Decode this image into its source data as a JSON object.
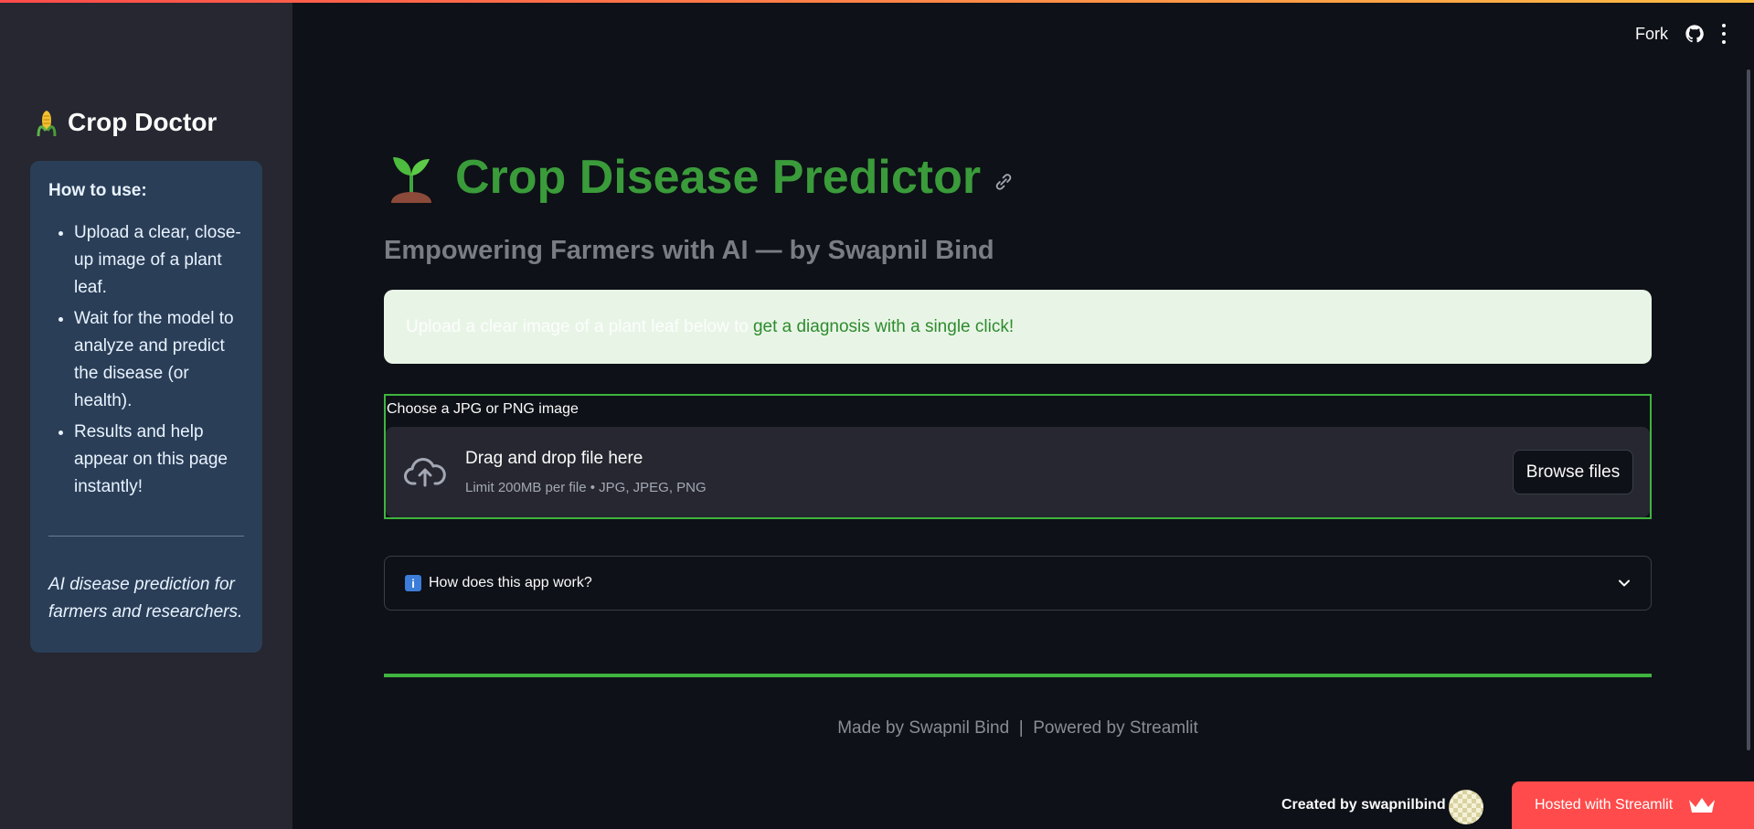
{
  "sidebar": {
    "brand_title": "Crop Doctor",
    "brand_icon": "corn-icon",
    "howto_title": "How to use:",
    "howto_items": [
      "Upload a clear, close-up image of a plant leaf.",
      "Wait for the model to analyze and predict the disease (or health).",
      "Results and help appear on this page instantly!"
    ],
    "note": "AI disease prediction for farmers and researchers."
  },
  "header": {
    "fork_label": "Fork",
    "github_icon": "github-icon",
    "menu_icon": "kebab-menu-icon"
  },
  "main": {
    "title": "Crop Disease Predictor",
    "title_icon": "seedling-icon",
    "subtitle": "Empowering Farmers with AI — by Swapnil Bind",
    "banner": {
      "faint_text": "Upload a clear image of a plant leaf below to ",
      "green_text": "get a diagnosis with a single click!"
    },
    "uploader": {
      "label": "Choose a JPG or PNG image",
      "drop_title": "Drag and drop file here",
      "drop_sub": "Limit 200MB per file • JPG, JPEG, PNG",
      "browse_label": "Browse files"
    },
    "expander_label": "How does this app work?",
    "footer": "Made by Swapnil Bind  |  Powered by Streamlit"
  },
  "bottom": {
    "created_by": "Created by swapnilbind",
    "hosted_label": "Hosted with Streamlit"
  },
  "colors": {
    "accent_green": "#3a9b3a",
    "streamlit_red": "#ff4b4b",
    "sidebar_card": "#2a3e57"
  }
}
